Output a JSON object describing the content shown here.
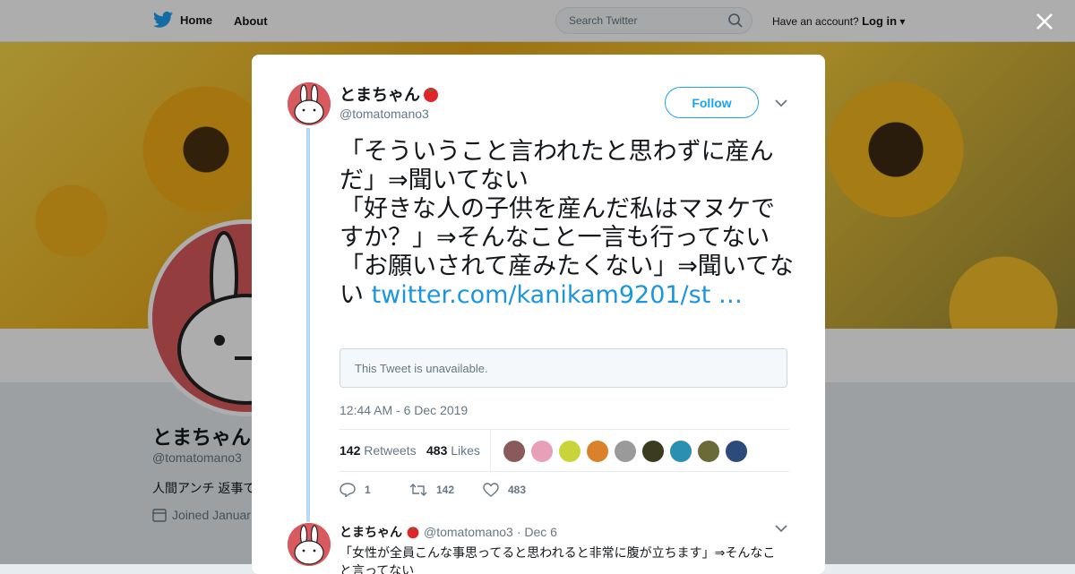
{
  "nav": {
    "home_label": "Home",
    "about_label": "About",
    "search_placeholder": "Search Twitter",
    "have_account": "Have an account?",
    "login_label": "Log in"
  },
  "background_profile": {
    "name": "とまちゃん",
    "handle": "@tomatomano3",
    "bio": "人間アンチ 返事で",
    "joined": "Joined Januar"
  },
  "tweet": {
    "author_name": "とまちゃん",
    "author_emoji": "🍅",
    "author_handle": "@tomatomano3",
    "follow_label": "Follow",
    "text": "「そういうこと言われたと思わずに産んだ」⇒聞いてない\n「好きな人の子供を産んだ私はマヌケですか？」⇒そんなこと一言も行ってない\n「お願いされて産みたくない」⇒聞いてない ",
    "link_text": "twitter.com/kanikam9201/st …",
    "quote_unavailable": "This Tweet is unavailable.",
    "timestamp": "12:44 AM - 6 Dec 2019",
    "retweets_count": "142",
    "retweets_label": "Retweets",
    "likes_count": "483",
    "likes_label": "Likes",
    "reply_count": "1",
    "retweet_action_count": "142",
    "like_action_count": "483",
    "likers": [
      "#8a5a5a",
      "#e8a0b8",
      "#c9d33a",
      "#d9822b",
      "#9a9a9a",
      "#3b3b1f",
      "#2a8fb0",
      "#6b6b3a",
      "#2c4a7a"
    ]
  },
  "reply": {
    "author_name": "とまちゃん",
    "author_emoji": "🍅",
    "author_handle": "@tomatomano3",
    "date": "· Dec 6",
    "text": "「女性が全員こんな事思ってると思われると非常に腹が立ちます」⇒そんなこと言ってない"
  },
  "colors": {
    "accent": "#1da1f2",
    "thread_line": "#b3dbf5",
    "tomato": "#e0242a"
  }
}
